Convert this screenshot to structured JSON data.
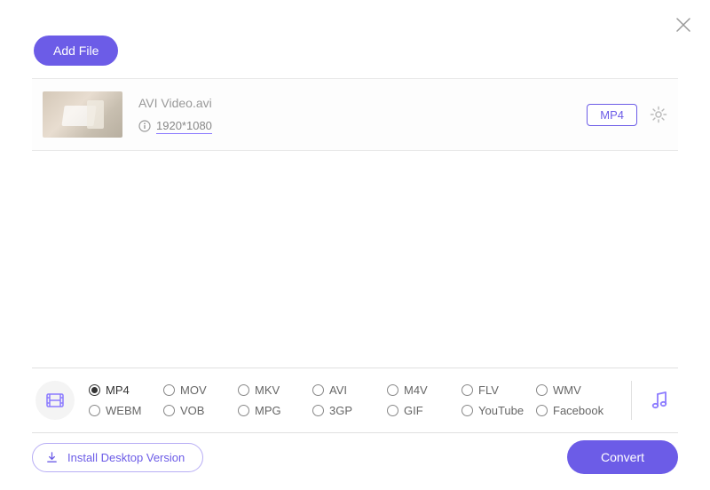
{
  "header": {
    "add_file_label": "Add File"
  },
  "file": {
    "name": "AVI Video.avi",
    "resolution": "1920*1080",
    "output_format": "MP4"
  },
  "formats": {
    "selected": "MP4",
    "row1": [
      "MP4",
      "MOV",
      "MKV",
      "AVI",
      "M4V",
      "FLV",
      "WMV"
    ],
    "row2": [
      "WEBM",
      "VOB",
      "MPG",
      "3GP",
      "GIF",
      "YouTube",
      "Facebook"
    ]
  },
  "footer": {
    "install_label": "Install Desktop Version",
    "convert_label": "Convert"
  },
  "colors": {
    "accent": "#6C5CE7"
  }
}
